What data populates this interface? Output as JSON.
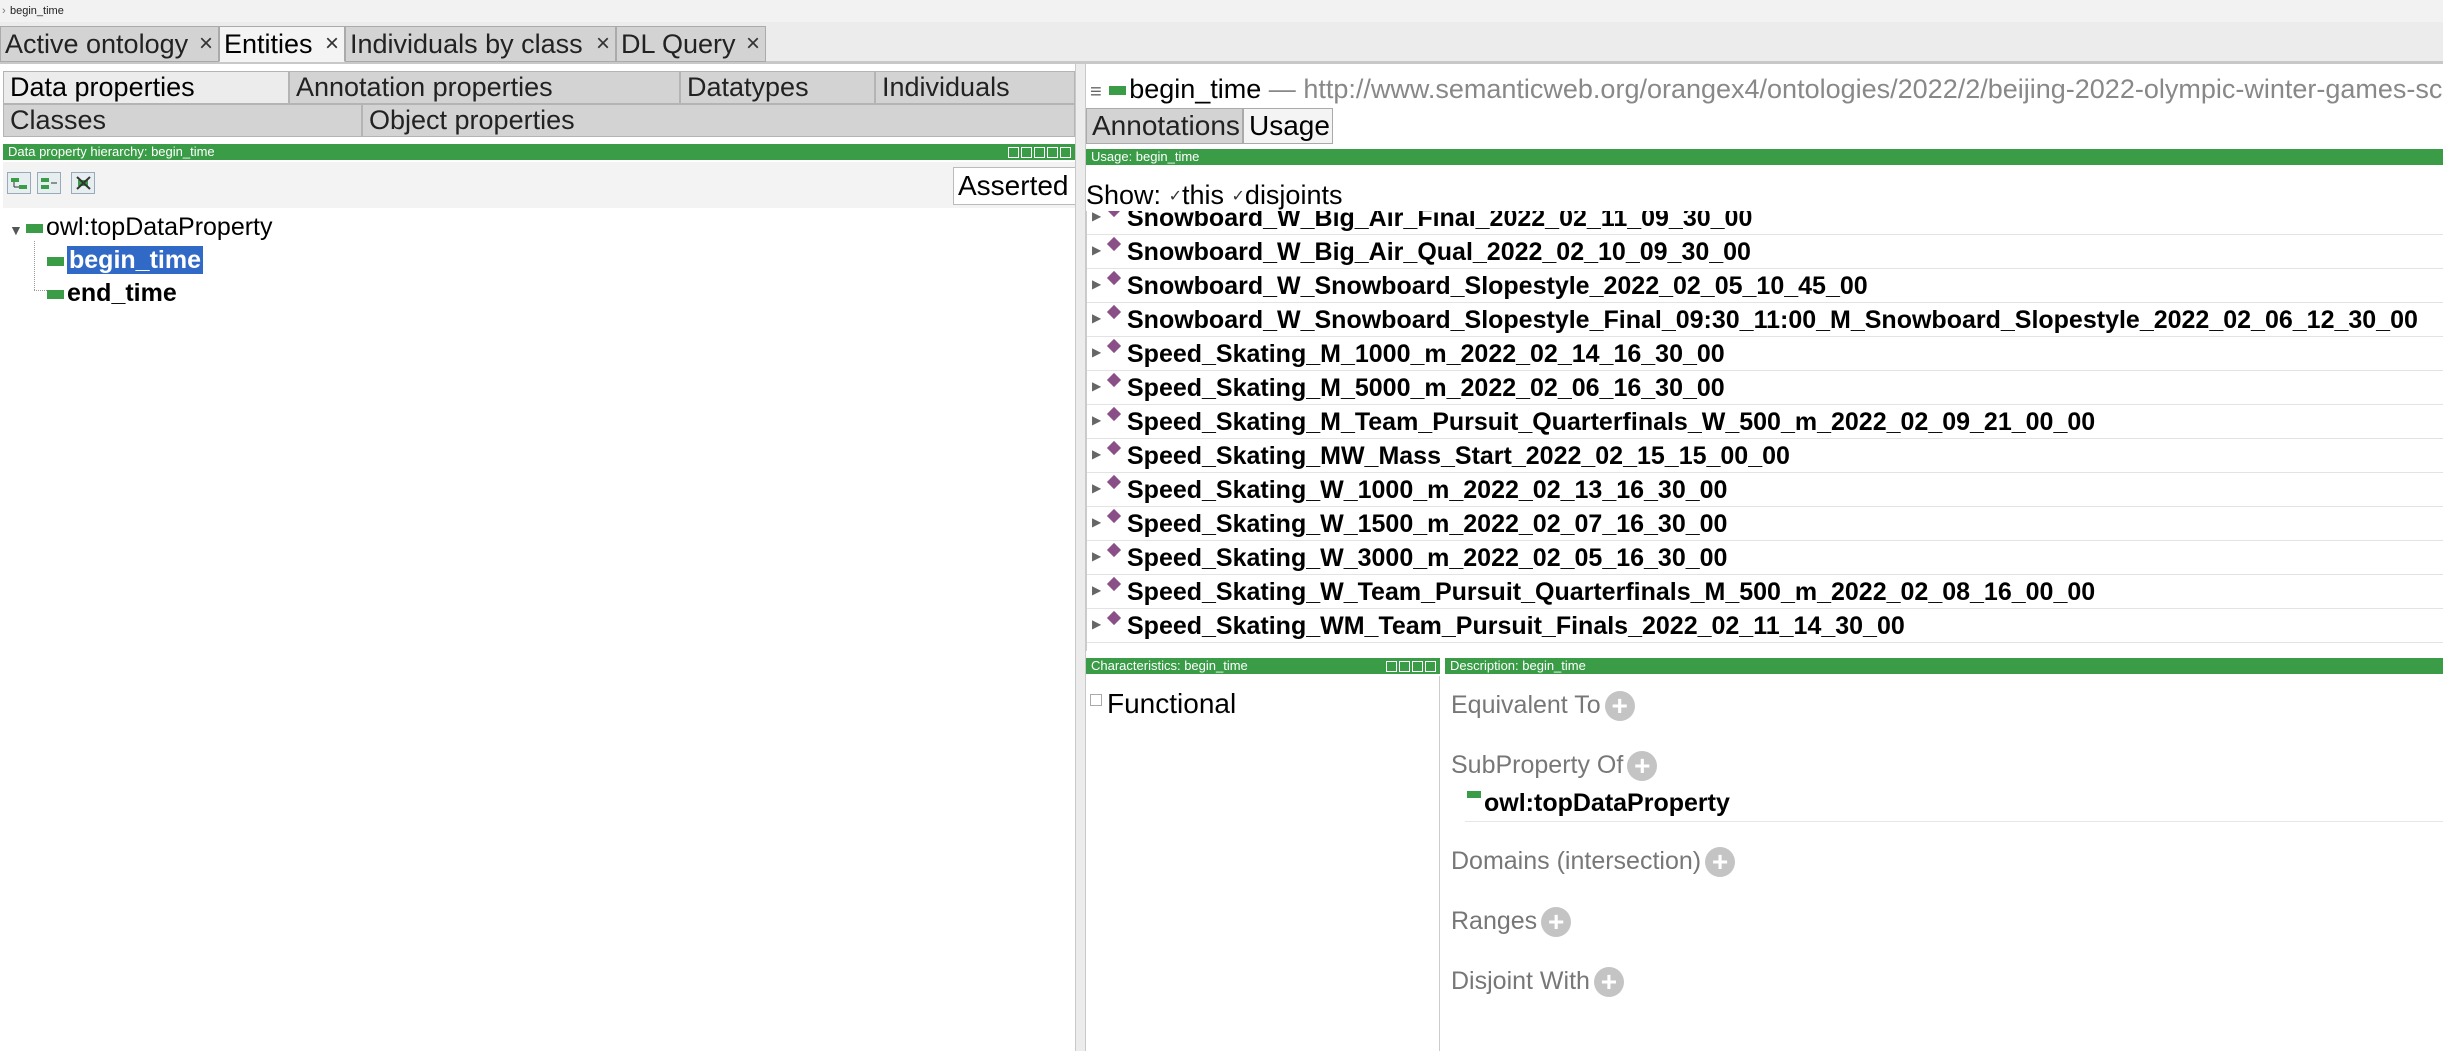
{
  "breadcrumb": "begin_time",
  "top_tabs": [
    {
      "label": "Active ontology",
      "close": "×"
    },
    {
      "label": "Entities",
      "close": "×"
    },
    {
      "label": "Individuals by class",
      "close": "×"
    },
    {
      "label": "DL Query",
      "close": "×"
    }
  ],
  "entity_tabs": {
    "row1": [
      "Data properties",
      "Annotation properties",
      "Datatypes",
      "Individuals"
    ],
    "row2": [
      "Classes",
      "Object properties"
    ]
  },
  "hierarchy": {
    "title": "Data property hierarchy: begin_time",
    "mode": "Asserted",
    "root": "owl:topDataProperty",
    "children": [
      "begin_time",
      "end_time"
    ],
    "selected": "begin_time"
  },
  "header": {
    "entity": "begin_time",
    "separator": "—",
    "iri": "http://www.semanticweb.org/orangex4/ontologies/2022/2/beijing-2022-olympic-winter-games-sc"
  },
  "right_tabs": [
    "Annotations",
    "Usage"
  ],
  "usage": {
    "title": "Usage: begin_time",
    "show_label": "Show:",
    "opt_this": "this",
    "opt_disjoints": "disjoints",
    "items": [
      "Snowboard_W_Big_Air_Final_2022_02_11_09_30_00",
      "Snowboard_W_Big_Air_Qual_2022_02_10_09_30_00",
      "Snowboard_W_Snowboard_Slopestyle_2022_02_05_10_45_00",
      "Snowboard_W_Snowboard_Slopestyle_Final_09:30_11:00_M_Snowboard_Slopestyle_2022_02_06_12_30_00",
      "Speed_Skating_M_1000_m_2022_02_14_16_30_00",
      "Speed_Skating_M_5000_m_2022_02_06_16_30_00",
      "Speed_Skating_M_Team_Pursuit_Quarterfinals_W_500_m_2022_02_09_21_00_00",
      "Speed_Skating_MW_Mass_Start_2022_02_15_15_00_00",
      "Speed_Skating_W_1000_m_2022_02_13_16_30_00",
      "Speed_Skating_W_1500_m_2022_02_07_16_30_00",
      "Speed_Skating_W_3000_m_2022_02_05_16_30_00",
      "Speed_Skating_W_Team_Pursuit_Quarterfinals_M_500_m_2022_02_08_16_00_00",
      "Speed_Skating_WM_Team_Pursuit_Finals_2022_02_11_14_30_00"
    ]
  },
  "characteristics": {
    "title": "Characteristics: begin_time",
    "functional": "Functional"
  },
  "description": {
    "title": "Description: begin_time",
    "equivalent_to": "Equivalent To",
    "subproperty_of": "SubProperty Of",
    "subproperty_value": "owl:topDataProperty",
    "domains": "Domains (intersection)",
    "ranges": "Ranges",
    "disjoint_with": "Disjoint With"
  },
  "colors": {
    "accent_green": "#3a9c47",
    "selection": "#3169c6",
    "individual": "#8a4f86"
  }
}
